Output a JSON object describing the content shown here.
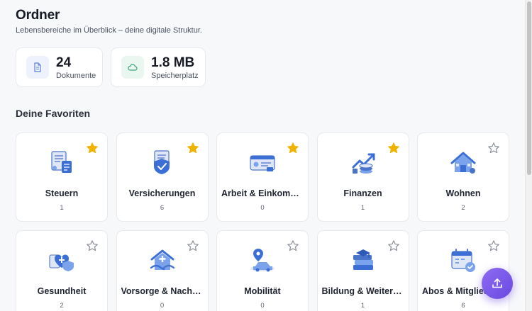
{
  "header": {
    "title": "Ordner",
    "subtitle": "Lebensbereiche im Überblick – deine digitale Struktur."
  },
  "stats": [
    {
      "value": "24",
      "label": "Dokumente",
      "icon": "document-icon"
    },
    {
      "value": "1.8 MB",
      "label": "Speicherplatz",
      "icon": "cloud-icon"
    }
  ],
  "favorites": {
    "title": "Deine Favoriten",
    "items": [
      {
        "name": "Steuern",
        "count": "1",
        "favorite": true,
        "icon": "tax-documents-icon"
      },
      {
        "name": "Versicherungen",
        "count": "6",
        "favorite": true,
        "icon": "shield-insurance-icon"
      },
      {
        "name": "Arbeit & Einkommen",
        "count": "0",
        "favorite": true,
        "icon": "id-card-icon"
      },
      {
        "name": "Finanzen",
        "count": "1",
        "favorite": true,
        "icon": "coins-growth-icon"
      },
      {
        "name": "Wohnen",
        "count": "2",
        "favorite": false,
        "icon": "house-icon"
      },
      {
        "name": "Gesundheit",
        "count": "2",
        "favorite": false,
        "icon": "health-hearts-icon"
      },
      {
        "name": "Vorsorge & Nachlass",
        "count": "0",
        "favorite": false,
        "icon": "care-house-icon"
      },
      {
        "name": "Mobilität",
        "count": "0",
        "favorite": false,
        "icon": "car-pin-icon"
      },
      {
        "name": "Bildung & Weiterbildung",
        "count": "1",
        "favorite": false,
        "icon": "books-icon"
      },
      {
        "name": "Abos & Mitgliedschaften",
        "count": "6",
        "favorite": false,
        "icon": "subscription-calendar-icon"
      }
    ]
  },
  "colors": {
    "star_active": "#f0b400",
    "star_inactive": "#8a8f99",
    "accent": "#7b5cf0"
  },
  "fab": {
    "icon": "upload-icon"
  }
}
